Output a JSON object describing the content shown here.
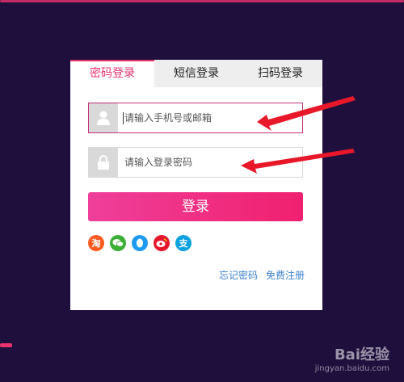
{
  "tabs": [
    {
      "label": "密码登录",
      "active": true
    },
    {
      "label": "短信登录",
      "active": false
    },
    {
      "label": "扫码登录",
      "active": false
    }
  ],
  "form": {
    "account": {
      "value": "",
      "placeholder": "请输入手机号或邮箱",
      "icon": "user-icon"
    },
    "password": {
      "value": "",
      "placeholder": "请输入登录密码",
      "icon": "lock-icon"
    },
    "submit_label": "登录"
  },
  "social": [
    {
      "name": "taobao-icon",
      "glyph": "淘",
      "color": "#ff5a1f"
    },
    {
      "name": "wechat-icon",
      "glyph": "●",
      "color": "#3cb034"
    },
    {
      "name": "qq-icon",
      "glyph": "●",
      "color": "#1e9bf0"
    },
    {
      "name": "weibo-icon",
      "glyph": "●",
      "color": "#e6162d"
    },
    {
      "name": "alipay-icon",
      "glyph": "支",
      "color": "#0ea1e0"
    }
  ],
  "links": {
    "forgot": "忘记密码",
    "register": "免费注册"
  },
  "colors": {
    "accent": "#e8336d",
    "background": "#1f0f3c",
    "link": "#3a7fcf"
  },
  "watermark": {
    "brand": "Bai经验",
    "url": "jingyan.baidu.com"
  }
}
